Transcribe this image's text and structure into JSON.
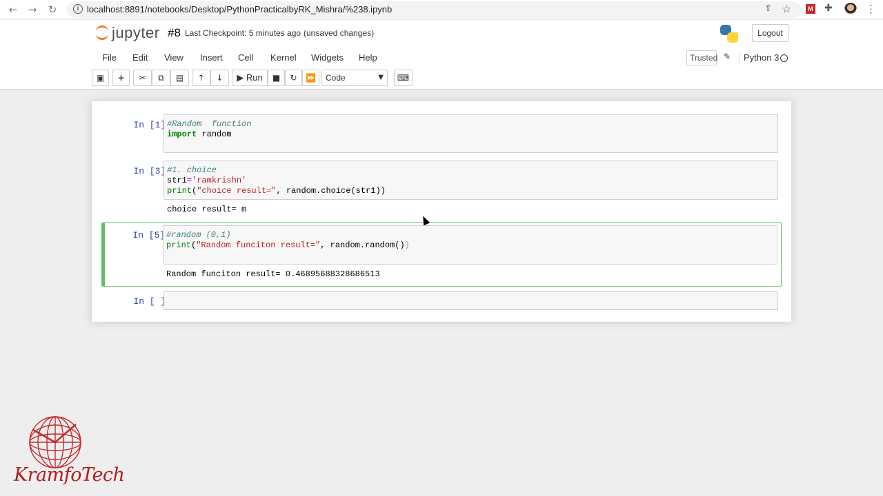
{
  "browser": {
    "url": "localhost:8891/notebooks/Desktop/PythonPracticalbyRK_Mishra/%238.ipynb"
  },
  "header": {
    "brand": "jupyter",
    "notebook_name": "#8",
    "checkpoint": "Last Checkpoint: 5 minutes ago",
    "status": "(unsaved changes)",
    "logout_label": "Logout"
  },
  "menu": {
    "items": [
      "File",
      "Edit",
      "View",
      "Insert",
      "Cell",
      "Kernel",
      "Widgets",
      "Help"
    ],
    "trusted_label": "Trusted",
    "kernel_name": "Python 3"
  },
  "toolbar": {
    "run_label": "Run",
    "cell_type": "Code"
  },
  "cells": [
    {
      "prompt": "In [1]:",
      "code": [
        "#Random  function",
        "import random"
      ],
      "output": ""
    },
    {
      "prompt": "In [3]:",
      "code": [
        "#1. choice",
        "str1='ramkrishn'",
        "print(\"choice result=\", random.choice(str1))"
      ],
      "output": "choice result= m"
    },
    {
      "prompt": "In [5]:",
      "code": [
        "#random (0,1)",
        "print(\"Random funciton result=\", random.random())"
      ],
      "output": "Random funciton result= 0.46895688328686513"
    },
    {
      "prompt": "In [ ]:",
      "code": [],
      "output": ""
    }
  ],
  "watermark": {
    "text": "KramfoTech"
  },
  "colors": {
    "prompt_in": "#303f9f",
    "selected_cell_border": "#66bb6a",
    "jupyter_orange": "#f37726"
  }
}
